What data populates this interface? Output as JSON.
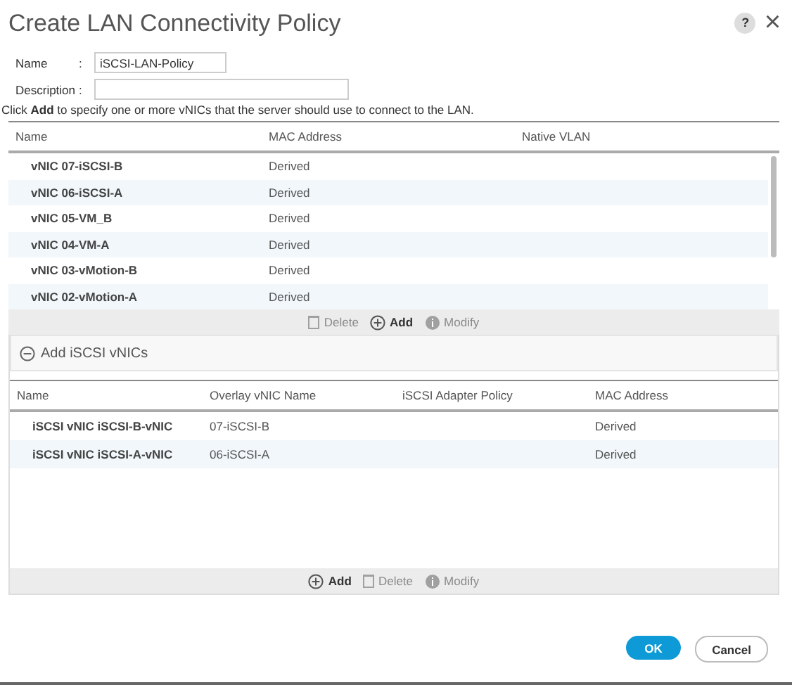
{
  "window": {
    "title": "Create LAN Connectivity Policy",
    "help": "?",
    "close": "×"
  },
  "form": [
    {
      "label": "Name",
      "separator": ":",
      "value": "iSCSI-LAN-Policy"
    },
    {
      "label": "Description",
      "separator": ":"
    }
  ],
  "hint": "Click **Add** to specify one or more vNICs that the server should use to connect to the LAN.",
  "vnic_table": {
    "columns": [
      "Name",
      "MAC Address",
      "Native VLAN"
    ],
    "rows": [
      [
        "vNIC 07-iSCSI-B",
        "Derived",
        ""
      ],
      [
        "vNIC 06-iSCSI-A",
        "Derived",
        ""
      ],
      [
        "vNIC 05-VM_B",
        "Derived",
        ""
      ],
      [
        "vNIC 04-VM-A",
        "Derived",
        ""
      ],
      [
        "vNIC 03-vMotion-B",
        "Derived",
        ""
      ],
      [
        "vNIC 02-vMotion-A",
        "Derived",
        ""
      ]
    ],
    "actions": [
      {
        "kind": "delete",
        "label": "Delete",
        "disabled": true
      },
      {
        "kind": "add",
        "label": "Add",
        "disabled": false
      },
      {
        "kind": "modify",
        "label": "Modify",
        "disabled": true
      }
    ]
  },
  "iscsi_section": {
    "title": "Add iSCSI vNICs",
    "expanded": true,
    "columns": [
      "Name",
      "Overlay vNIC Name",
      "iSCSI Adapter Policy",
      "MAC Address"
    ],
    "rows": [
      [
        "iSCSI vNIC iSCSI-B-vNIC",
        "07-iSCSI-B",
        "",
        "Derived"
      ],
      [
        "iSCSI vNIC iSCSI-A-vNIC",
        "06-iSCSI-A",
        "",
        "Derived"
      ]
    ],
    "actions": [
      {
        "kind": "add",
        "label": "Add",
        "disabled": false
      },
      {
        "kind": "delete",
        "label": "Delete",
        "disabled": true
      },
      {
        "kind": "modify",
        "label": "Modify",
        "disabled": true
      }
    ]
  },
  "buttons": [
    {
      "kind": "primary",
      "label": "OK"
    },
    {
      "kind": "secondary",
      "label": "Cancel"
    }
  ]
}
